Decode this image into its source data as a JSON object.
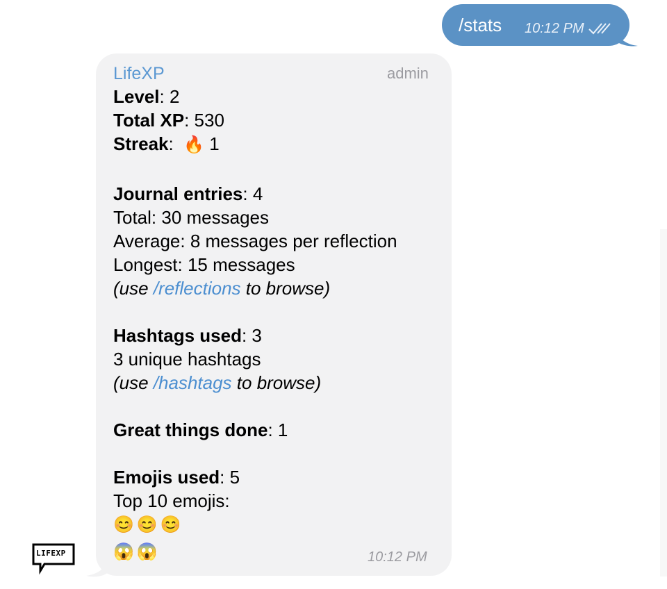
{
  "outgoing": {
    "text": "/stats",
    "time": "10:12 PM",
    "bubble_color": "#5b92c5"
  },
  "incoming": {
    "bot_name": "LifeXP",
    "role": "admin",
    "time": "10:12 PM",
    "bubble_color": "#f2f2f3",
    "level_label": "Level",
    "level_value": ": 2",
    "xp_label": "Total XP",
    "xp_value": ": 530",
    "streak_label": "Streak",
    "streak_value": "1",
    "streak_emoji": "🔥",
    "journal_label": "Journal entries",
    "journal_value": ": 4",
    "journal_total": "Total: 30 messages",
    "journal_average": "Average: 8 messages per reflection",
    "journal_longest": "Longest: 15 messages",
    "reflections_pre": "(use ",
    "reflections_link": "/reflections",
    "reflections_post": " to browse)",
    "hashtags_label": "Hashtags used",
    "hashtags_value": ": 3",
    "hashtags_unique": "3 unique hashtags",
    "hashtags_pre": "(use ",
    "hashtags_link": "/hashtags",
    "hashtags_post": " to browse)",
    "great_label": "Great things done",
    "great_value": ": 1",
    "emojis_label": "Emojis used",
    "emojis_value": ": 5",
    "emojis_top": "Top 10 emojis:",
    "emoji_row1": "😊😊😊",
    "emoji_row2": "😱😱"
  },
  "avatar": {
    "text": "LIFEXP"
  }
}
